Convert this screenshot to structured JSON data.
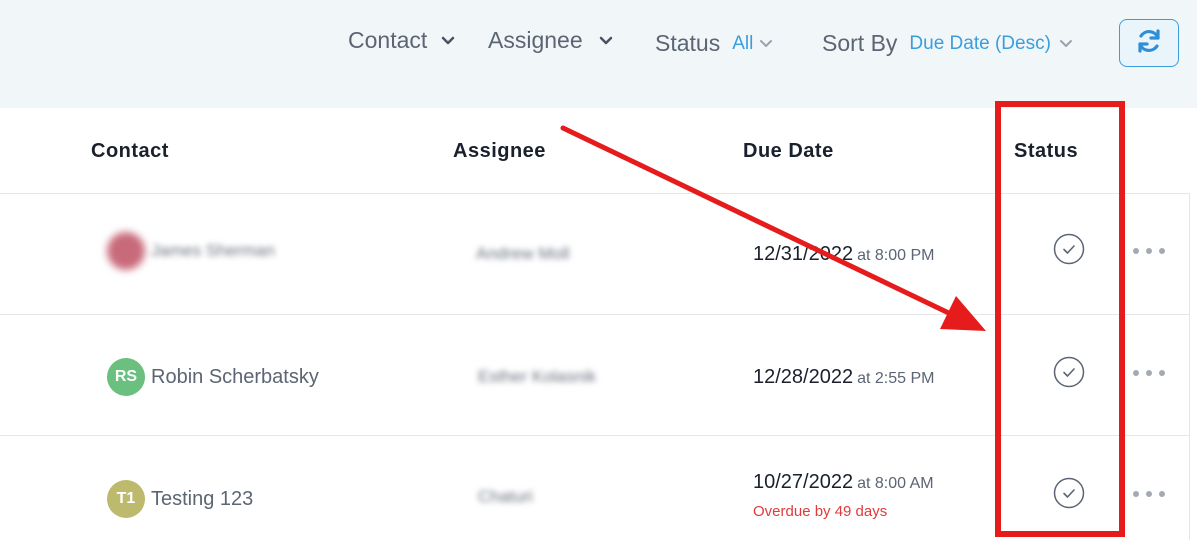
{
  "filters": {
    "contact_label": "Contact",
    "assignee_label": "Assignee",
    "status_label": "Status",
    "status_value": "All",
    "sort_label": "Sort By",
    "sort_value": "Due Date (Desc)",
    "refresh_icon": "refresh-icon"
  },
  "table": {
    "headers": {
      "contact": "Contact",
      "assignee": "Assignee",
      "due_date": "Due Date",
      "status": "Status"
    },
    "rows": [
      {
        "contact_name": "James Sherman",
        "avatar_initials": "",
        "avatar_color": "#c86a7a",
        "assignee": "Andrew Moll",
        "due_date": "12/31/2022",
        "due_time": "at 8:00 PM",
        "overdue": "",
        "status_icon": "check-circle-icon"
      },
      {
        "contact_name": "Robin Scherbatsky",
        "avatar_initials": "RS",
        "avatar_color": "#6bbf7f",
        "assignee": "Esther Kolasnik",
        "due_date": "12/28/2022",
        "due_time": "at 2:55 PM",
        "overdue": "",
        "status_icon": "check-circle-icon"
      },
      {
        "contact_name": "Testing 123",
        "avatar_initials": "T1",
        "avatar_color": "#bdb96d",
        "assignee": "Chaturi",
        "due_date": "10/27/2022",
        "due_time": "at 8:00 AM",
        "overdue": "Overdue by 49 days",
        "status_icon": "check-circle-icon"
      }
    ]
  },
  "colors": {
    "accent": "#3b9edc",
    "overdue": "#e03b3b",
    "annotation": "#e61b1b",
    "filter_bg": "#f1f6f9"
  }
}
